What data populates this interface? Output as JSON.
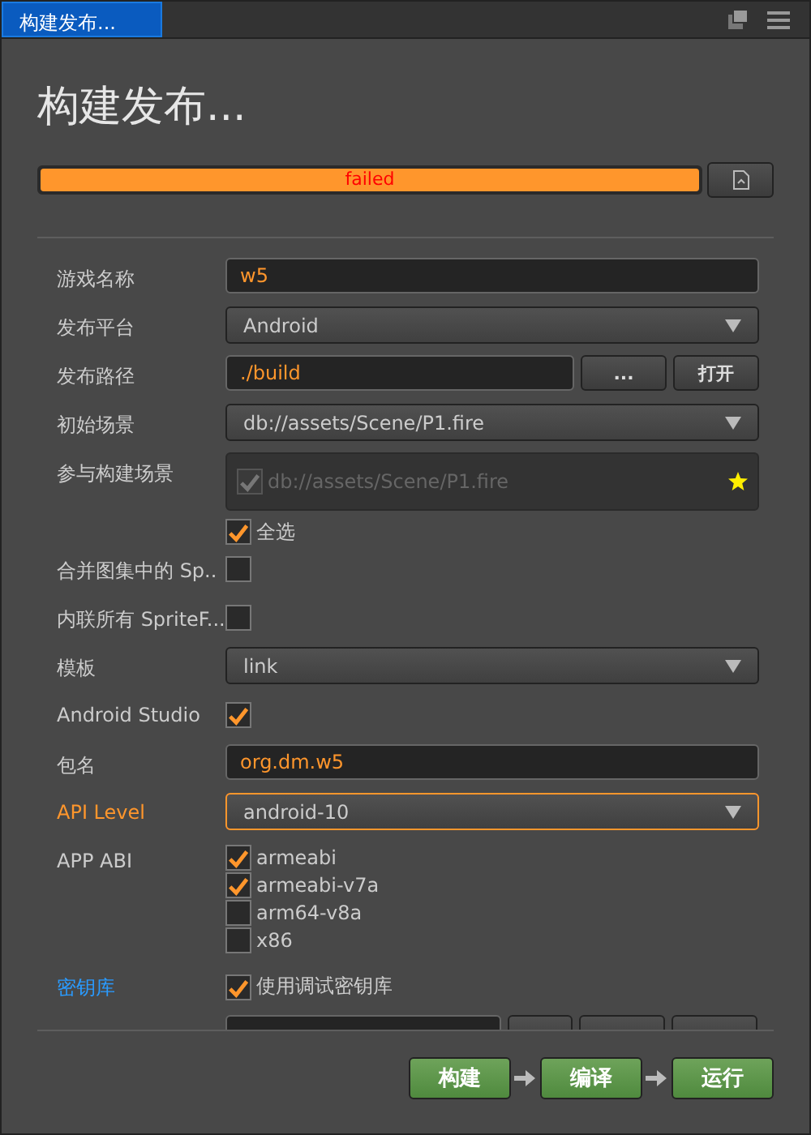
{
  "tab": {
    "title": "构建发布...",
    "selected": true
  },
  "heading": "构建发布...",
  "progress": {
    "level": 1,
    "text": "failed"
  },
  "rows": [
    {
      "kind": "text",
      "label": "游戏名称",
      "value": "w5"
    },
    {
      "kind": "select",
      "label": "发布平台",
      "value": "Android"
    },
    {
      "kind": "path",
      "label": "发布路径",
      "value": "./build",
      "buttons": [
        "...",
        "打开"
      ]
    },
    {
      "kind": "select",
      "label": "初始场景",
      "value": "db://assets/Scene/P1.fire"
    },
    {
      "kind": "scenes",
      "label": "参与构建场景",
      "scenes": [
        {
          "path": "db://assets/Scene/P1.fire",
          "checked": true,
          "disabled": true,
          "starred": true
        }
      ],
      "select_all": {
        "label": "全选",
        "checked": true
      }
    },
    {
      "kind": "checkbox",
      "label": "合并图集中的 Sp..",
      "checked": false
    },
    {
      "kind": "checkbox",
      "label": "内联所有 SpriteF...",
      "checked": false
    },
    {
      "kind": "select",
      "label": "模板",
      "value": "link"
    },
    {
      "kind": "checkbox",
      "label": "Android Studio",
      "checked": true
    },
    {
      "kind": "text",
      "label": "包名",
      "value": "org.dm.w5"
    },
    {
      "kind": "select",
      "label": "API Level",
      "value": "android-10",
      "focused": true
    },
    {
      "kind": "checklist",
      "label": "APP ABI",
      "options": [
        {
          "label": "armeabi",
          "checked": true
        },
        {
          "label": "armeabi-v7a",
          "checked": true
        },
        {
          "label": "arm64-v8a",
          "checked": false
        },
        {
          "label": "x86",
          "checked": false
        }
      ]
    },
    {
      "kind": "checkbox",
      "label": "密钥库",
      "option": "使用调试密钥库",
      "checked": true,
      "link": true
    },
    {
      "kind": "clipped"
    }
  ],
  "actions": [
    "构建",
    "编译",
    "运行"
  ]
}
